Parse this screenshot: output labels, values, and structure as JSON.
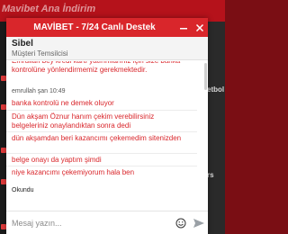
{
  "background": {
    "topbar_text": "Mavibet Ana İndirim",
    "right_labels": [
      "etbol",
      "rs"
    ]
  },
  "chat": {
    "title": "MAVİBET - 7/24 Canlı Destek",
    "colors": {
      "header": "#d9262b",
      "message_text": "#d9262b"
    },
    "agent": {
      "name": "Sibel",
      "role": "Müşteri Temsilcisi"
    },
    "previous_message": "Emrullah bey kredi kartı yatırımlarınız için size banka kontrolüne yönlendirmemiz gerekmektedir.",
    "sender_line": "emrullah şan 10:49",
    "messages": [
      "banka kontrolü ne demek oluyor",
      "Dün akşam Öznur hanım çekim verebilirsiniz belgeleriniz onaylandıktan sonra dedi",
      "dün akşamdan beri kazancımı çekemedim sitenizden",
      "belge onayı da yaptım şimdi",
      "niye kazancımı çekemiyorum hala ben"
    ],
    "read_status": "Okundu",
    "composer": {
      "placeholder": "Mesaj yazın..."
    },
    "icons": {
      "minimize": "minimize-icon",
      "close": "close-icon",
      "emoji": "emoji-icon",
      "send": "send-icon"
    }
  }
}
